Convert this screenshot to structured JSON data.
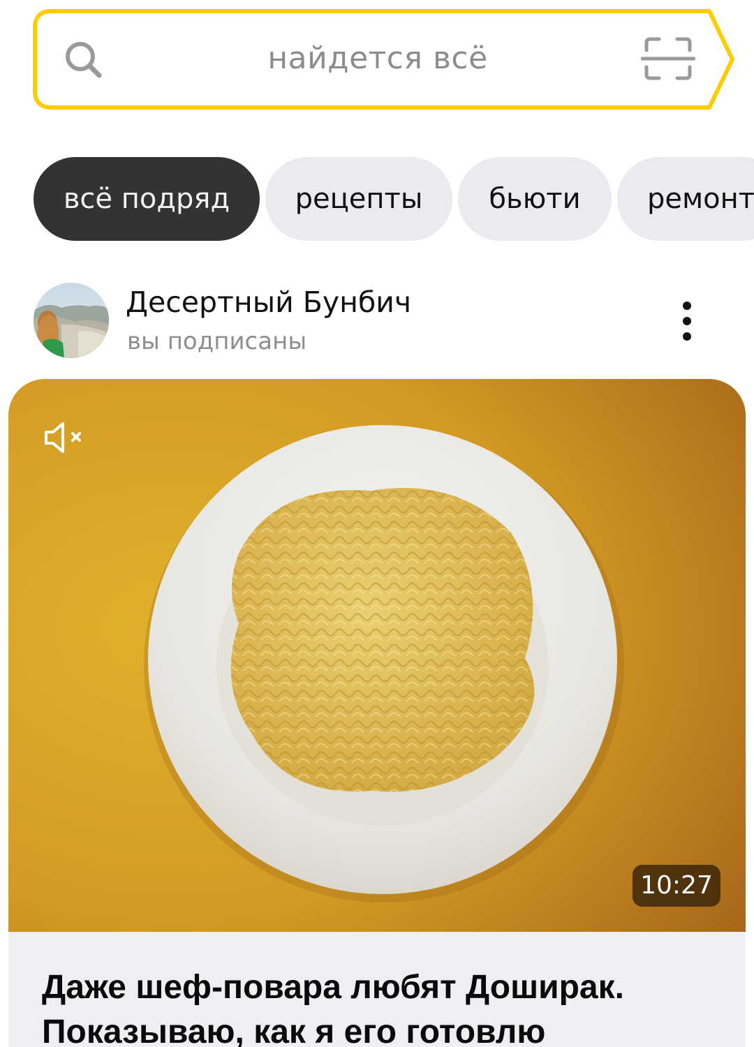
{
  "search": {
    "placeholder": "найдется всё",
    "accent_color": "#ffcc00"
  },
  "icons": {
    "search": "search-icon",
    "scan": "scan-icon",
    "more": "more-vertical-icon",
    "mute": "volume-muted-icon"
  },
  "chips": [
    {
      "label": "всё подряд",
      "active": true
    },
    {
      "label": "рецепты",
      "active": false
    },
    {
      "label": "бьюти",
      "active": false
    },
    {
      "label": "ремонт",
      "active": false
    }
  ],
  "post": {
    "channel_name": "Десертный Бунбич",
    "channel_status": "вы подписаны",
    "duration": "10:27",
    "title": "Даже шеф-повара любят Доширак. Показываю, как я его готовлю"
  }
}
